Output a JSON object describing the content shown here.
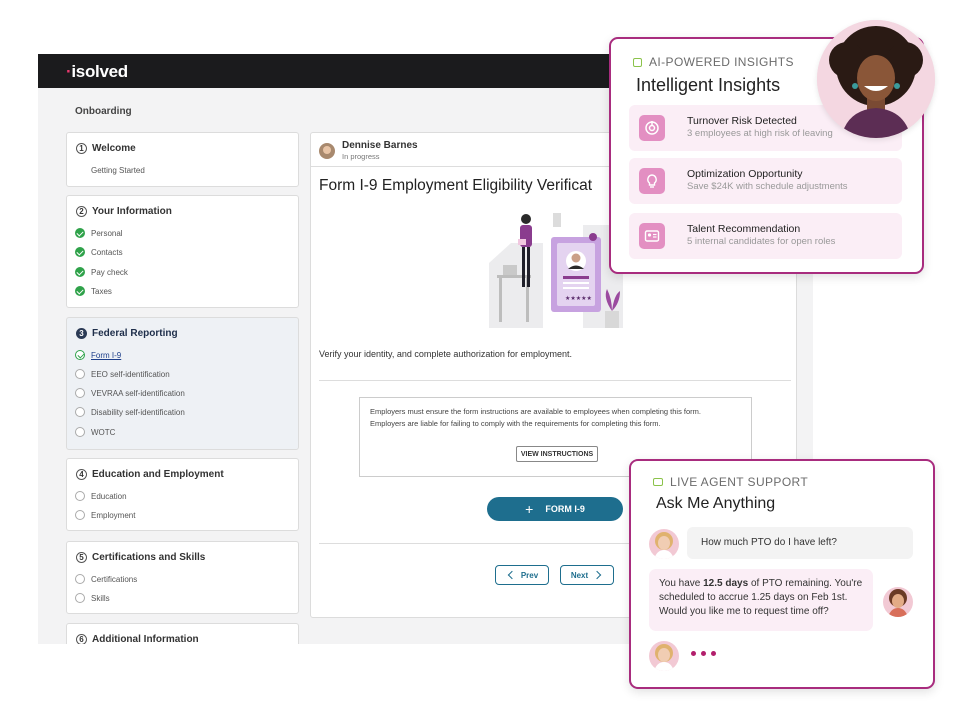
{
  "app": {
    "logo": "isolved",
    "page_title": "Onboarding"
  },
  "steps": [
    {
      "number": "1",
      "title": "Welcome",
      "subtitle": "Getting Started"
    },
    {
      "number": "2",
      "title": "Your Information",
      "items": [
        "Personal",
        "Contacts",
        "Pay check",
        "Taxes"
      ]
    },
    {
      "number": "3",
      "title": "Federal Reporting",
      "items": [
        "Form I-9",
        "EEO self-identification",
        "VEVRAA self-identification",
        "Disability self-identification",
        "WOTC"
      ]
    },
    {
      "number": "4",
      "title": "Education and Employment",
      "items": [
        "Education",
        "Employment"
      ]
    },
    {
      "number": "5",
      "title": "Certifications and Skills",
      "items": [
        "Certifications",
        "Skills"
      ]
    },
    {
      "number": "6",
      "title": "Additional Information"
    }
  ],
  "form": {
    "user_name": "Dennise Barnes",
    "user_status": "In progress",
    "title": "Form I-9 Employment Eligibility Verificat",
    "description": "Verify your identity, and complete authorization for employment.",
    "notice_line1": "Employers must ensure the form instructions are available to employees when completing this form.",
    "notice_line2": "Employers are liable for failing to comply with the requirements for completing this form.",
    "view_instructions_label": "VIEW INSTRUCTIONS",
    "form_button_label": "FORM I-9",
    "prev_label": "Prev",
    "next_label": "Next"
  },
  "insights": {
    "eyebrow": "AI-POWERED INSIGHTS",
    "title": "Intelligent Insights",
    "items": [
      {
        "title": "Turnover Risk Detected",
        "subtitle": "3 employees at high risk of leaving",
        "icon": "target-icon"
      },
      {
        "title": "Optimization Opportunity",
        "subtitle": "Save $24K with schedule adjustments",
        "icon": "lightbulb-icon"
      },
      {
        "title": "Talent Recommendation",
        "subtitle": "5 internal candidates for open roles",
        "icon": "id-card-icon"
      }
    ]
  },
  "chat": {
    "eyebrow": "LIVE AGENT SUPPORT",
    "title": "Ask Me Anything",
    "question": "How much PTO do I have left?",
    "answer_prefix": "You have ",
    "answer_bold": "12.5 days",
    "answer_suffix": " of PTO remaining. You're scheduled to accrue 1.25 days on Feb 1st. Would you like me to request time off?"
  },
  "colors": {
    "accent_magenta": "#a82c7e",
    "primary_teal": "#1e6e8e",
    "success_green": "#2fa24a",
    "topbar": "#1b1b1d"
  }
}
